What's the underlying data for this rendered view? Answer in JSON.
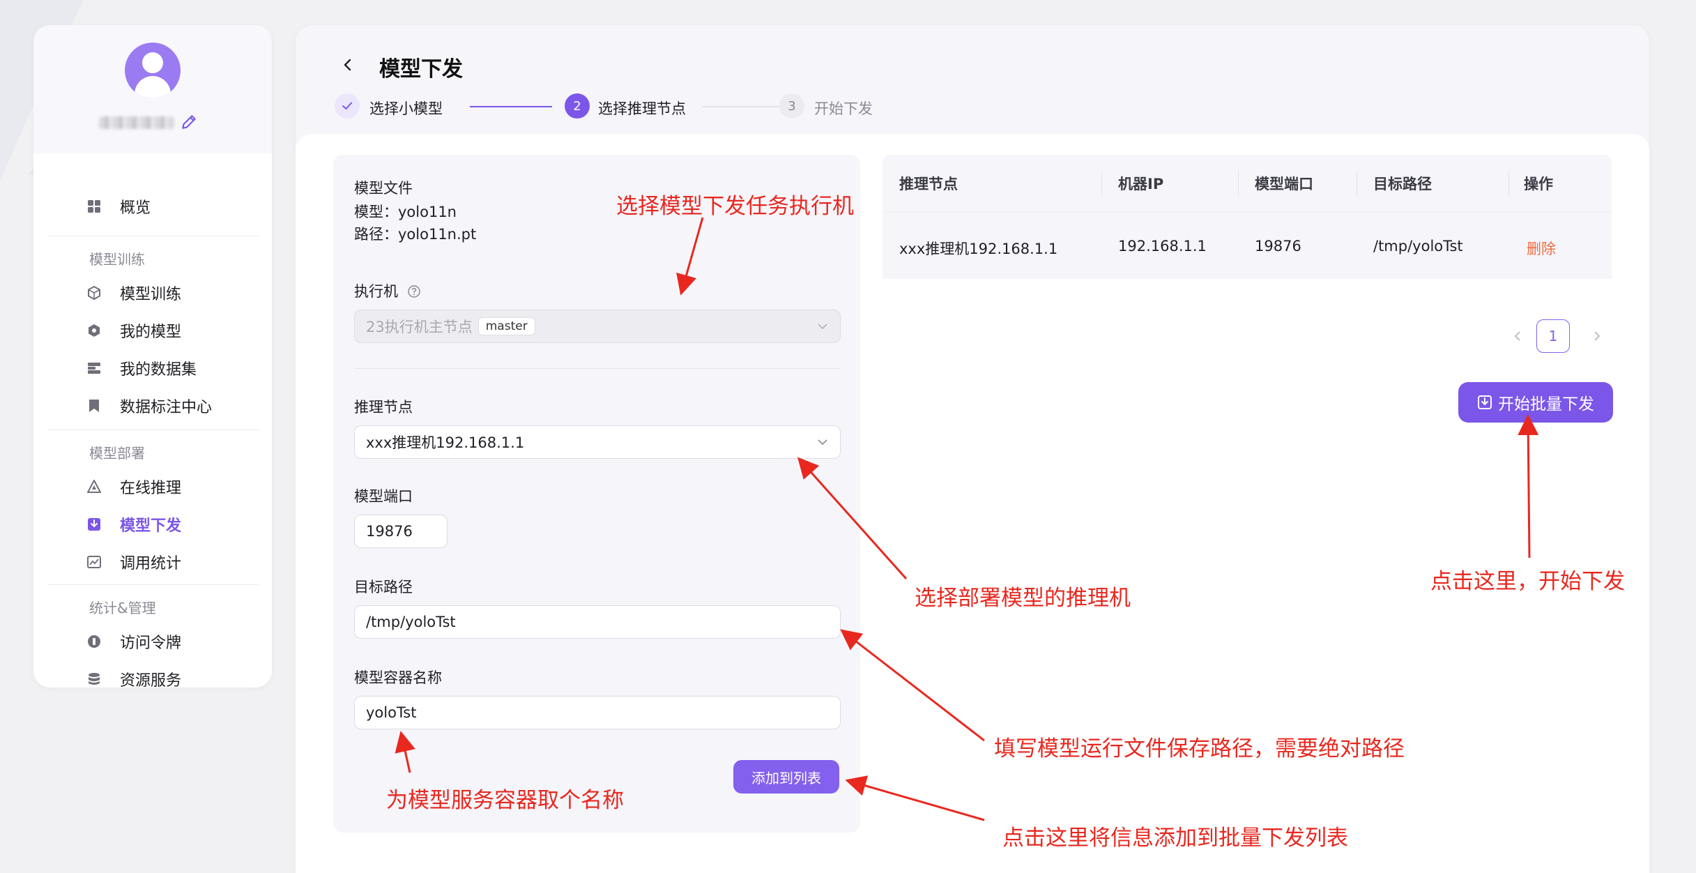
{
  "colors": {
    "accent": "#7b56e8",
    "accent_light": "#8460ee",
    "annotation_red": "#e8281f",
    "danger": "#f06b3f"
  },
  "sidebar": {
    "username": "",
    "items": [
      {
        "label": "概览",
        "icon": "grid-icon"
      },
      {
        "group": "模型训练"
      },
      {
        "label": "模型训练",
        "icon": "cube-icon"
      },
      {
        "label": "我的模型",
        "icon": "hexagon-icon"
      },
      {
        "label": "我的数据集",
        "icon": "dataset-icon"
      },
      {
        "label": "数据标注中心",
        "icon": "bookmark-icon"
      },
      {
        "group": "模型部署"
      },
      {
        "label": "在线推理",
        "icon": "triangle-icon"
      },
      {
        "label": "模型下发",
        "icon": "download-box-icon",
        "active": true
      },
      {
        "label": "调用统计",
        "icon": "chart-icon"
      },
      {
        "group": "统计&管理"
      },
      {
        "label": "访问令牌",
        "icon": "token-icon"
      },
      {
        "label": "资源服务",
        "icon": "database-icon"
      }
    ]
  },
  "header": {
    "title": "模型下发",
    "steps": [
      {
        "number": "1",
        "label": "选择小模型",
        "status": "done"
      },
      {
        "number": "2",
        "label": "选择推理节点",
        "status": "active"
      },
      {
        "number": "3",
        "label": "开始下发",
        "status": "pending"
      }
    ]
  },
  "form": {
    "model_file_label": "模型文件",
    "model_line": "模型：yolo11n",
    "path_line": "路径：yolo11n.pt",
    "executor_label": "执行机",
    "executor_value": "23执行机主节点",
    "executor_tag": "master",
    "node_label": "推理节点",
    "node_value": "xxx推理机192.168.1.1",
    "port_label": "模型端口",
    "port_value": "19876",
    "target_label": "目标路径",
    "target_value": "/tmp/yoloTst",
    "container_label": "模型容器名称",
    "container_value": "yoloTst",
    "add_button": "添加到列表"
  },
  "table": {
    "columns": [
      "推理节点",
      "机器IP",
      "模型端口",
      "目标路径",
      "操作"
    ],
    "rows": [
      {
        "node": "xxx推理机192.168.1.1",
        "ip": "192.168.1.1",
        "port": "19876",
        "path": "/tmp/yoloTst",
        "action": "删除"
      }
    ],
    "page": "1",
    "batch_button": "开始批量下发"
  },
  "annotations": {
    "executor": "选择模型下发任务执行机",
    "node": "选择部署模型的推理机",
    "path": "填写模型运行文件保存路径，需要绝对路径",
    "container": "为模型服务容器取个名称",
    "add": "点击这里将信息添加到批量下发列表",
    "start": "点击这里，开始下发"
  }
}
